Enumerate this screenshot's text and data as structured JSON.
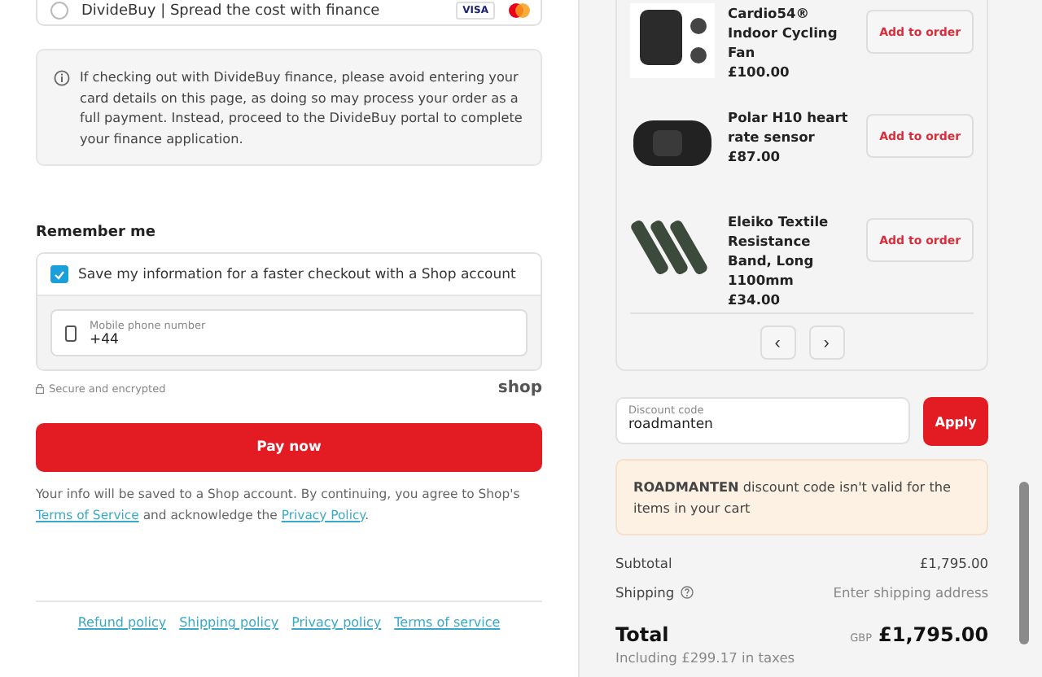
{
  "payment_option": {
    "label": "DivideBuy | Spread the cost with finance",
    "selected": false,
    "card_badges": [
      "VISA"
    ]
  },
  "finance_notice": "If checking out with DivideBuy finance, please avoid entering your card details on this page, as doing so may process your order as a full payment. Instead, proceed to the DivideBuy portal to complete your finance application.",
  "remember_me": {
    "heading": "Remember me",
    "checkbox_label": "Save my information for a faster checkout with a Shop account",
    "checked": true,
    "phone": {
      "label": "Mobile phone number",
      "value": "+44"
    },
    "secure_note": "Secure and encrypted",
    "brand": "shop"
  },
  "pay_button": "Pay now",
  "consent": {
    "text_before": "Your info will be saved to a Shop account. By continuing, you agree to Shop's",
    "terms_link": "Terms of Service",
    "text_middle": "and acknowledge the",
    "privacy_link": "Privacy Policy",
    "text_after": "."
  },
  "footer_links": [
    "Refund policy",
    "Shipping policy",
    "Privacy policy",
    "Terms of service"
  ],
  "products": [
    {
      "name": "Cardio54® Indoor Cycling Fan",
      "price": "£100.00",
      "button": "Add to order",
      "kind": "fan"
    },
    {
      "name": "Polar H10 heart rate sensor",
      "price": "£87.00",
      "button": "Add to order",
      "kind": "strap"
    },
    {
      "name": "Eleiko Textile Resistance Band, Long 1100mm",
      "price": "£34.00",
      "button": "Add to order",
      "kind": "bands"
    }
  ],
  "pager": [
    "‹",
    "›"
  ],
  "discount": {
    "label": "Discount code",
    "value": "roadmanten",
    "button": "Apply"
  },
  "discount_error": "**ROADMANTEN** discount code isn't valid for the items in your cart",
  "summary": {
    "subtotal_label": "Subtotal",
    "subtotal": "£1,795.00",
    "shipping_label": "Shipping",
    "shipping": "Enter shipping address",
    "total_label": "Total",
    "currency": "GBP",
    "total": "£1,795.00",
    "taxes": "Including £299.17 in taxes"
  }
}
